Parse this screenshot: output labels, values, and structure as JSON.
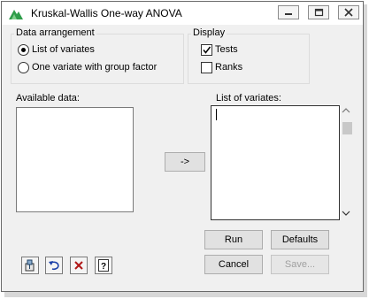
{
  "window": {
    "title": "Kruskal-Wallis One-way ANOVA"
  },
  "data_arrangement": {
    "label": "Data arrangement",
    "options": [
      "List of variates",
      "One variate with group factor"
    ],
    "selected": 0
  },
  "display": {
    "label": "Display",
    "options": [
      {
        "label": "Tests",
        "checked": true
      },
      {
        "label": "Ranks",
        "checked": false
      }
    ]
  },
  "available_data": {
    "label": "Available data:"
  },
  "list_of_variates": {
    "label": "List of variates:"
  },
  "transfer_button": {
    "label": "->"
  },
  "buttons": {
    "run": "Run",
    "defaults": "Defaults",
    "cancel": "Cancel",
    "save": "Save..."
  },
  "icons": [
    "app-icon",
    "minimize-icon",
    "maximize-icon",
    "close-icon",
    "pin-icon",
    "undo-icon",
    "clear-icon",
    "help-icon",
    "scroll-up-icon",
    "scroll-down-icon"
  ]
}
